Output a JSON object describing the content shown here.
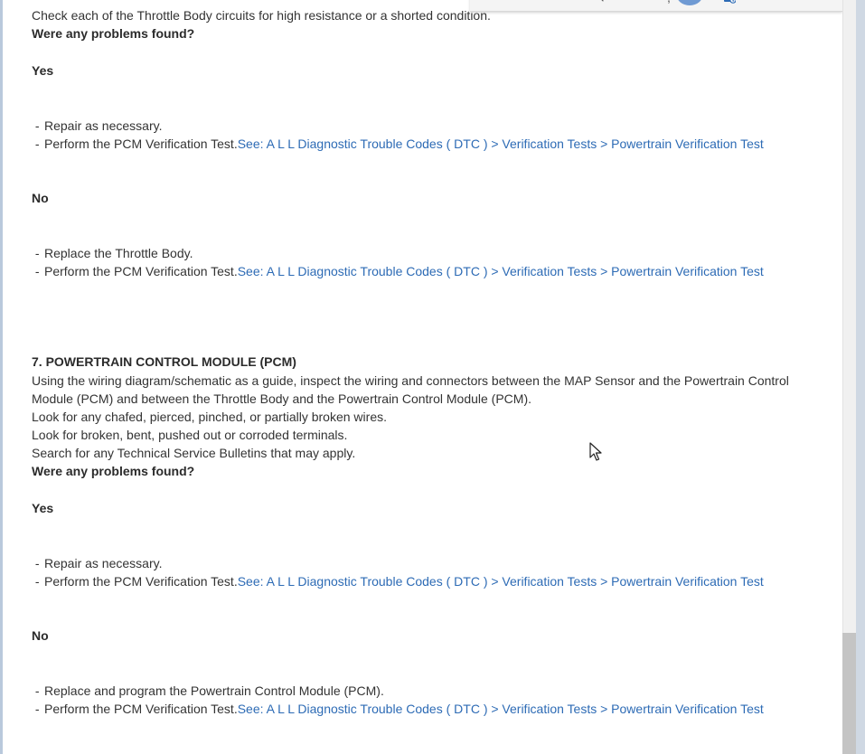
{
  "header": {
    "partial_text": "Check each of the Throttle Body circuits for high resistance or a shorted condition."
  },
  "link_text": "See: A L L Diagnostic Trouble Codes ( DTC ) > Verification Tests > Powertrain Verification Test",
  "step6": {
    "question": "Were any problems found?",
    "yes_label": "Yes",
    "yes_items": [
      "Repair as necessary.",
      "Perform the PCM Verification Test."
    ],
    "no_label": "No",
    "no_items": [
      "Replace the Throttle Body.",
      "Perform the PCM Verification Test."
    ]
  },
  "step7": {
    "title": "7. POWERTRAIN CONTROL MODULE (PCM)",
    "desc_line1": "Using the wiring diagram/schematic as a guide, inspect the wiring and connectors between the MAP Sensor and the Powertrain Control",
    "desc_line2": "Module (PCM) and between the Throttle Body and the Powertrain Control Module (PCM).",
    "check1": "Look for any chafed, pierced, pinched, or partially broken wires.",
    "check2": "Look for broken, bent, pushed out or corroded terminals.",
    "check3": "Search for any Technical Service Bulletins that may apply.",
    "question": "Were any problems found?",
    "yes_label": "Yes",
    "yes_items": [
      "Repair as necessary.",
      "Perform the PCM Verification Test."
    ],
    "no_label": "No",
    "no_items": [
      "Replace and program the Powertrain Control Module (PCM).",
      "Perform the PCM Verification Test."
    ]
  },
  "colors": {
    "link": "#2d6bb5",
    "text": "#333333",
    "avatar": "#6f9ad3"
  },
  "icons": [
    "arrow-icon",
    "avatar",
    "document-icon",
    "mouse-cursor-icon"
  ]
}
